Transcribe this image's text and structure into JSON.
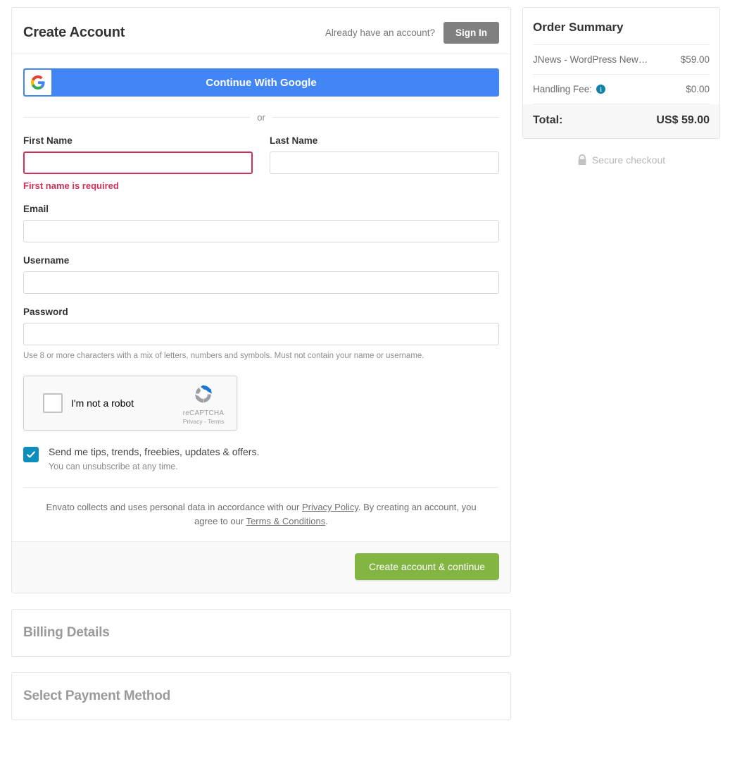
{
  "account": {
    "title": "Create Account",
    "have_account_text": "Already have an account?",
    "sign_in_label": "Sign In",
    "google_button_label": "Continue With Google",
    "or_label": "or",
    "fields": {
      "first_name_label": "First Name",
      "first_name_value": "",
      "first_name_error": "First name is required",
      "last_name_label": "Last Name",
      "last_name_value": "",
      "email_label": "Email",
      "email_value": "",
      "username_label": "Username",
      "username_value": "",
      "password_label": "Password",
      "password_value": "",
      "password_hint": "Use 8 or more characters with a mix of letters, numbers and symbols. Must not contain your name or username."
    },
    "recaptcha": {
      "label": "I'm not a robot",
      "brand": "reCAPTCHA",
      "links": "Privacy - Terms"
    },
    "newsletter": {
      "label": "Send me tips, trends, freebies, updates & offers.",
      "sub_label": "You can unsubscribe at any time.",
      "checked": true
    },
    "legal": {
      "part1": "Envato collects and uses personal data in accordance with our ",
      "privacy_link": "Privacy Policy",
      "part2": ". By creating an account, you agree to our ",
      "terms_link": "Terms & Conditions",
      "part3": "."
    },
    "submit_label": "Create account & continue"
  },
  "sections": [
    {
      "title": "Billing Details"
    },
    {
      "title": "Select Payment Method"
    }
  ],
  "order_summary": {
    "title": "Order Summary",
    "items": [
      {
        "name": "JNews - WordPress New…",
        "price": "$59.00"
      }
    ],
    "handling_fee_label": "Handling Fee:",
    "handling_fee_value": "$0.00",
    "total_label": "Total:",
    "total_value": "US$ 59.00",
    "secure_text": "Secure checkout"
  },
  "colors": {
    "google_blue": "#4285f4",
    "submit_green": "#82b541",
    "error_crimson": "#d0315c",
    "checkbox_teal": "#0f8dbd",
    "info_blue": "#1081a8",
    "signin_gray": "#808080"
  }
}
